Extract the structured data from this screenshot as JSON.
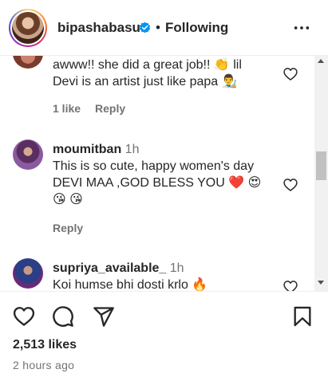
{
  "header": {
    "username": "bipashabasu",
    "separator": "•",
    "follow_status": "Following"
  },
  "comments": [
    {
      "username": "",
      "line1": "awww!! she did a great job!! 👏 lil",
      "line2": "Devi is an artist just like papa 👨‍🎨",
      "likes": "1 like",
      "reply": "Reply"
    },
    {
      "username": "moumitban",
      "time": "1h",
      "line1": "This is so cute, happy women's day",
      "line2": "DEVI MAA ,GOD BLESS YOU ❤️ 😍",
      "line3": "😘 😘",
      "reply": "Reply"
    },
    {
      "username": "supriya_available_",
      "time": "1h",
      "line1": "Koi humse bhi dosti krlo 🔥"
    }
  ],
  "footer": {
    "likes": "2,513 likes",
    "time_ago": "2 hours ago"
  },
  "colors": {
    "text": "#262626",
    "secondary": "#737373",
    "verified": "#0095f6",
    "heart_emoji": "#ed4956"
  },
  "icons": [
    "verified-badge-icon",
    "more-options-icon",
    "heart-outline-icon",
    "comment-icon",
    "share-icon",
    "bookmark-icon"
  ]
}
